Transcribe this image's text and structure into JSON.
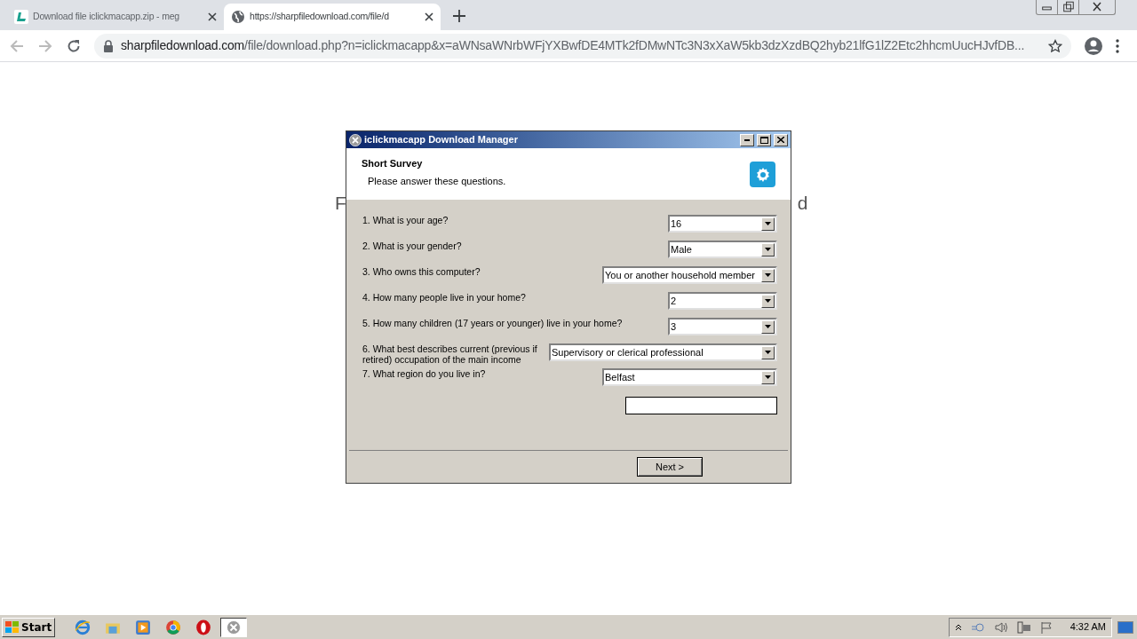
{
  "browser": {
    "tabs": [
      {
        "title": "Download file iclickmacapp.zip - meg",
        "selected": false
      },
      {
        "title": "https://sharpfiledownload.com/file/d",
        "selected": true
      }
    ],
    "url_host": "sharpfiledownload.com",
    "url_rest": "/file/download.php?n=iclickmacapp&x=aWNsaWNrbWFjYXBwfDE4MTk2fDMwNTc3N3xXaW5kb3dzXzdBQ2hyb21lfG1lZ2Etc2hhcmUucHJvfDB..."
  },
  "page": {
    "heading_left": "F",
    "heading_right": "d"
  },
  "dialog": {
    "title": "iclickmacapp Download Manager",
    "header_title": "Short Survey",
    "header_subtitle": "Please answer these questions.",
    "questions": [
      {
        "label": "1. What is your age?",
        "value": "16"
      },
      {
        "label": "2. What is your gender?",
        "value": "Male"
      },
      {
        "label": "3. Who owns this computer?",
        "value": "You or another household member"
      },
      {
        "label": "4. How many people live in your home?",
        "value": "2"
      },
      {
        "label": "5. How many children (17 years or younger) live in your home?",
        "value": "3"
      },
      {
        "label": "6. What best describes current (previous if retired) occupation of the main income",
        "value": "Supervisory or clerical professional"
      },
      {
        "label": "7. What region do you live in?",
        "value": "Belfast"
      }
    ],
    "next_button": "Next >"
  },
  "taskbar": {
    "start": "Start",
    "items": [
      {
        "kind": "ie",
        "selected": false
      },
      {
        "kind": "folder",
        "selected": false
      },
      {
        "kind": "media",
        "selected": false
      },
      {
        "kind": "chrome",
        "selected": false
      },
      {
        "kind": "opera",
        "selected": false
      },
      {
        "kind": "tool",
        "selected": true
      }
    ],
    "clock": "4:32 AM"
  }
}
